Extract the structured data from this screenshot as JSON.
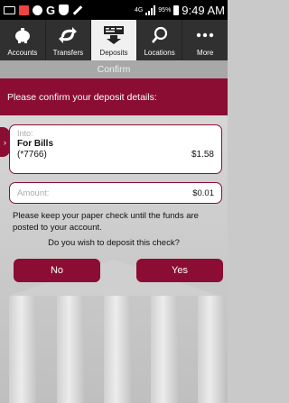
{
  "status_bar": {
    "network": "4G",
    "battery_percent": "95%",
    "time": "9:49 AM",
    "icons": [
      "mail-icon",
      "notification-icon",
      "chrome-icon",
      "google-icon",
      "shield-icon",
      "pen-icon"
    ]
  },
  "tabs": [
    {
      "label": "Accounts",
      "icon": "piggy-bank-icon",
      "active": false
    },
    {
      "label": "Transfers",
      "icon": "transfer-arrows-icon",
      "active": false
    },
    {
      "label": "Deposits",
      "icon": "deposit-icon",
      "active": true
    },
    {
      "label": "Locations",
      "icon": "search-icon",
      "active": false
    },
    {
      "label": "More",
      "icon": "more-dots-icon",
      "active": false
    }
  ],
  "header": {
    "title": "Confirm"
  },
  "banner": {
    "text": "Please confirm your deposit details:"
  },
  "into_card": {
    "label": "Into:",
    "account_name": "For Bills",
    "account_number": "(*7766)",
    "balance": "$1.58"
  },
  "amount_card": {
    "label": "Amount:",
    "value": "$0.01"
  },
  "note": "Please keep your paper check until the funds are posted to your account.",
  "question": "Do you wish to deposit this check?",
  "buttons": {
    "no": "No",
    "yes": "Yes"
  },
  "colors": {
    "accent": "#8b0d33",
    "tabbar": "#303030",
    "header": "#a8a8a8"
  }
}
